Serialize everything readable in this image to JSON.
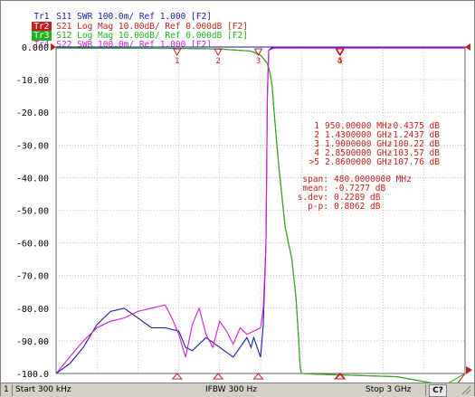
{
  "traces": [
    {
      "id": "Tr1",
      "param": "S11",
      "format": "SWR",
      "scale": "100.0m/",
      "ref": "Ref 1.000",
      "ch": "[F2]",
      "color": "#1a1aa0",
      "active": false
    },
    {
      "id": "Tr2",
      "param": "S21",
      "format": "Log Mag",
      "scale": "10.00dB/",
      "ref": "Ref 0.000dB",
      "ch": "[F2]",
      "color": "#c02020",
      "active": true
    },
    {
      "id": "Tr3",
      "param": "S12",
      "format": "Log Mag",
      "scale": "10.00dB/",
      "ref": "Ref 0.000dB",
      "ch": "[F2]",
      "color": "#20b020",
      "active": false
    },
    {
      "id": "Tr4",
      "param": "S22",
      "format": "SWR",
      "scale": "100.0m/",
      "ref": "Ref 1.000",
      "ch": "[F2]",
      "color": "#d020d0",
      "active": false
    }
  ],
  "y_ticks": [
    "0.000",
    "-10.00",
    "-20.00",
    "-30.00",
    "-40.00",
    "-50.00",
    "-60.00",
    "-70.00",
    "-80.00",
    "-90.00",
    "-100.0"
  ],
  "markers": [
    {
      "n": "1",
      "label": "1",
      "freq": "950.00000 MHz",
      "value": "-0.4375 dB",
      "pos": 0.2959
    },
    {
      "n": "2",
      "label": "2",
      "freq": "1.4300000 GHz",
      "value": "-1.2437 dB",
      "pos": 0.3962
    },
    {
      "n": "3",
      "label": "3",
      "freq": "1.9000000 GHz",
      "value": "-100.22 dB",
      "pos": 0.4944
    },
    {
      "n": "4",
      "label": "4",
      "freq": "2.8500000 GHz",
      "value": "-103.57 dB",
      "pos": 0.6931
    },
    {
      "n": "5",
      "label": ">5",
      "freq": "2.8600000 GHz",
      "value": "-107.76 dB",
      "pos": 0.6952
    }
  ],
  "stats": [
    {
      "label": "span:",
      "value": "480.0000000 MHz"
    },
    {
      "label": "mean:",
      "value": "-0.7277 dB"
    },
    {
      "label": "s.dev:",
      "value": "0.2289 dB"
    },
    {
      "label": "p-p:",
      "value": "0.8062 dB"
    }
  ],
  "status": {
    "channel": "1",
    "start": "Start 300 kHz",
    "ifbw": "IFBW 300 Hz",
    "stop": "Stop 3 GHz",
    "button": "C?"
  },
  "chart_data": {
    "type": "line",
    "x_range_hz": [
      300000,
      3000000000
    ],
    "ylim": [
      -100,
      0
    ],
    "grid": true,
    "series": [
      {
        "name": "S21",
        "color": "#c02020",
        "x_ghz": [
          0.0003,
          0.3,
          0.6,
          0.95,
          1.2,
          1.43,
          1.5,
          1.55,
          1.57,
          1.585,
          1.6,
          1.63,
          1.68,
          1.73,
          1.76,
          1.78,
          1.79,
          1.8,
          1.9,
          2.5,
          2.85,
          2.86,
          3.0
        ],
        "y_db": [
          -0.3,
          -0.35,
          -0.4,
          -0.44,
          -0.6,
          -1.24,
          -2.5,
          -5,
          -8,
          -12,
          -20,
          -35,
          -55,
          -65,
          -77,
          -90,
          -98,
          -100,
          -100.2,
          -101,
          -103.6,
          -107.8,
          -100
        ]
      },
      {
        "name": "S12",
        "color": "#20b020",
        "x_ghz": [
          0.0003,
          0.3,
          0.6,
          0.95,
          1.2,
          1.43,
          1.5,
          1.55,
          1.57,
          1.585,
          1.6,
          1.63,
          1.68,
          1.73,
          1.76,
          1.78,
          1.79,
          1.8,
          1.9,
          2.5,
          2.85,
          3.0
        ],
        "y_db": [
          -0.3,
          -0.35,
          -0.4,
          -0.44,
          -0.6,
          -1.24,
          -2.5,
          -5,
          -8,
          -12,
          -20,
          -35,
          -55,
          -65,
          -77,
          -90,
          -98,
          -100,
          -100.2,
          -101,
          -103.6,
          -100
        ]
      },
      {
        "name": "S11",
        "color": "#1a1aa0",
        "x_ghz": [
          0.0003,
          0.1,
          0.2,
          0.3,
          0.4,
          0.5,
          0.6,
          0.7,
          0.8,
          0.9,
          0.95,
          1.0,
          1.1,
          1.2,
          1.3,
          1.35,
          1.4,
          1.43,
          1.45,
          1.5,
          1.52,
          1.54,
          1.55,
          1.56,
          1.58,
          1.6,
          1.65,
          1.8,
          2.0,
          2.5,
          3.0
        ],
        "y_db": [
          -100,
          -97,
          -92,
          -85,
          -81,
          -80,
          -83,
          -86,
          -86,
          -87,
          -92,
          -93,
          -89,
          -92,
          -95,
          -92,
          -89,
          -92,
          -89,
          -95,
          -85,
          -60,
          -15,
          -1,
          -0.3,
          -0.3,
          -0.3,
          -0.3,
          -0.3,
          -0.3,
          -0.3
        ]
      },
      {
        "name": "S22",
        "color": "#d020d0",
        "x_ghz": [
          0.0003,
          0.1,
          0.2,
          0.3,
          0.4,
          0.5,
          0.6,
          0.7,
          0.8,
          0.85,
          0.9,
          0.95,
          1.0,
          1.05,
          1.1,
          1.15,
          1.2,
          1.25,
          1.3,
          1.35,
          1.4,
          1.45,
          1.5,
          1.52,
          1.54,
          1.55,
          1.56,
          1.6,
          3.0
        ],
        "y_db": [
          -100,
          -95,
          -90,
          -86,
          -84,
          -83,
          -81,
          -80,
          -79,
          -83,
          -88,
          -95,
          -85,
          -80,
          -88,
          -92,
          -84,
          -87,
          -91,
          -86,
          -88,
          -87,
          -86,
          -80,
          -60,
          -15,
          -1,
          -0.3,
          -0.3
        ]
      }
    ]
  }
}
